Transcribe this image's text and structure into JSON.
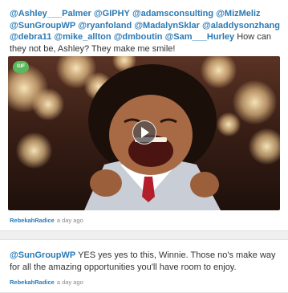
{
  "posts": [
    {
      "mentions": [
        "@Ashley___Palmer",
        "@GIPHY",
        "@adamsconsulting",
        "@MizMeliz",
        "@SunGroupWP",
        "@ryanfoland",
        "@MadalynSklar",
        "@aladdysonzhang",
        "@debra11",
        "@mike_allton",
        "@dmboutin",
        "@Sam___Hurley"
      ],
      "text": "How can they not be, Ashley? They make me smile!",
      "media": {
        "badge": "GIF",
        "icon": "play-icon"
      },
      "author": "RebekahRadice",
      "time": "a day ago"
    },
    {
      "mentions": [
        "@SunGroupWP"
      ],
      "text": "YES yes yes to this, Winnie. Those no's make way for all the amazing opportunities you'll have room to enjoy.",
      "author": "RebekahRadice",
      "time": "a day ago"
    }
  ],
  "colors": {
    "link": "#2a7ab5",
    "gif_badge": "#5cb85c"
  }
}
